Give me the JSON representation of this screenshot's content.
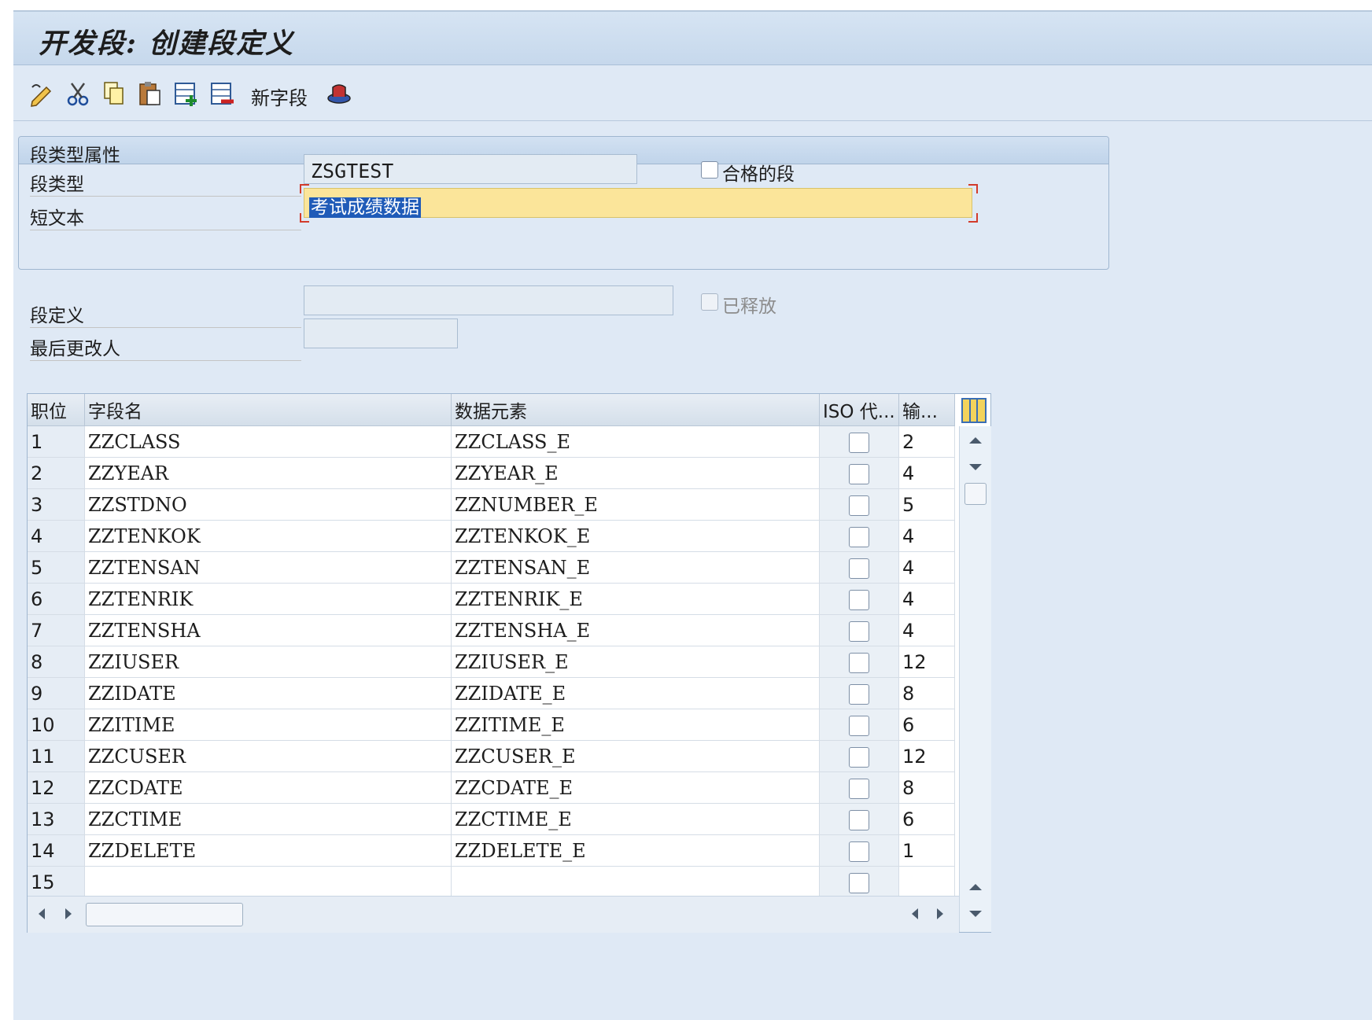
{
  "window": {
    "title": "开发段: 创建段定义"
  },
  "toolbar": {
    "icons": [
      "edit-icon",
      "cut-icon",
      "copy-icon",
      "paste-icon",
      "insert-row-icon",
      "delete-row-icon",
      "print-icon"
    ],
    "new_field_label": "新字段"
  },
  "attributes": {
    "panel_title": "段类型属性",
    "segment_type_label": "段类型",
    "segment_type_value": "ZSGTEST",
    "qualified_label": "合格的段",
    "short_text_label": "短文本",
    "short_text_value": "考试成绩数据"
  },
  "definition": {
    "segment_def_label": "段定义",
    "segment_def_value": "",
    "released_label": "已释放",
    "last_changed_label": "最后更改人",
    "last_changed_value": ""
  },
  "table": {
    "headers": [
      "职位",
      "字段名",
      "数据元素",
      "ISO 代...",
      "输..."
    ],
    "rows": [
      {
        "pos": "1",
        "field": "ZZCLASS",
        "element": "ZZCLASS_E",
        "len": "2"
      },
      {
        "pos": "2",
        "field": "ZZYEAR",
        "element": "ZZYEAR_E",
        "len": "4"
      },
      {
        "pos": "3",
        "field": "ZZSTDNO",
        "element": "ZZNUMBER_E",
        "len": "5"
      },
      {
        "pos": "4",
        "field": "ZZTENKOK",
        "element": "ZZTENKOK_E",
        "len": "4"
      },
      {
        "pos": "5",
        "field": "ZZTENSAN",
        "element": "ZZTENSAN_E",
        "len": "4"
      },
      {
        "pos": "6",
        "field": "ZZTENRIK",
        "element": "ZZTENRIK_E",
        "len": "4"
      },
      {
        "pos": "7",
        "field": "ZZTENSHA",
        "element": "ZZTENSHA_E",
        "len": "4"
      },
      {
        "pos": "8",
        "field": "ZZIUSER",
        "element": "ZZIUSER_E",
        "len": "12"
      },
      {
        "pos": "9",
        "field": "ZZIDATE",
        "element": "ZZIDATE_E",
        "len": "8"
      },
      {
        "pos": "10",
        "field": "ZZITIME",
        "element": "ZZITIME_E",
        "len": "6"
      },
      {
        "pos": "11",
        "field": "ZZCUSER",
        "element": "ZZCUSER_E",
        "len": "12"
      },
      {
        "pos": "12",
        "field": "ZZCDATE",
        "element": "ZZCDATE_E",
        "len": "8"
      },
      {
        "pos": "13",
        "field": "ZZCTIME",
        "element": "ZZCTIME_E",
        "len": "6"
      },
      {
        "pos": "14",
        "field": "ZZDELETE",
        "element": "ZZDELETE_E",
        "len": "1"
      },
      {
        "pos": "15",
        "field": "",
        "element": "",
        "len": ""
      }
    ]
  }
}
